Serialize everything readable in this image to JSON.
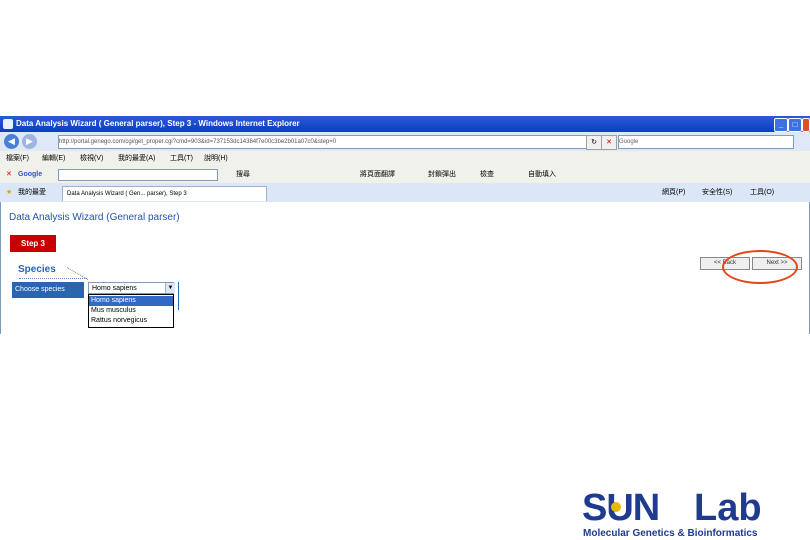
{
  "window": {
    "title": "Data Analysis Wizard ( General parser), Step 3 - Windows Internet Explorer",
    "controls": [
      "_",
      "□",
      "×"
    ]
  },
  "address_bar": {
    "url": "http://portal.genego.com/cgi/get_proper.cgi?cmd=903&id=737153dc14384f7e00c3be2b01a07c0&step=0",
    "search_placeholder": "Google"
  },
  "menu": {
    "items": [
      "檔案(F)",
      "編輯(E)",
      "檢視(V)",
      "我的最愛(A)",
      "工具(T)",
      "說明(H)"
    ]
  },
  "google_toolbar": {
    "logo": "Google",
    "items": [
      "搜尋",
      "將頁面翻譯",
      "封鎖彈出",
      "檢查",
      "自動填入"
    ]
  },
  "tabs": {
    "favorites_label": "我的最愛",
    "active_tab": "Data Analysis Wizard ( Gen... parser), Step 3",
    "right_items": [
      "網頁(P)",
      "安全性(S)",
      "工具(O)"
    ]
  },
  "page": {
    "title": "Data Analysis Wizard (General parser)",
    "step_label": "Step 3",
    "section_label": "Species",
    "field_label": "Choose species",
    "selected_value": "Homo sapiens",
    "options": [
      "Homo sapiens",
      "Mus musculus",
      "Rattus norvegicus"
    ],
    "selected_index": 0,
    "back_label": "<< Back",
    "next_label": "Next >>"
  },
  "logo": {
    "main_left": "SUN",
    "main_right": "Lab",
    "subtitle": "Molecular Genetics & Bioinformatics"
  },
  "colors": {
    "accent_blue": "#2a65b0",
    "step_red": "#c70000",
    "highlight_circle": "#e2461a",
    "logo_blue": "#1f3b8f"
  }
}
